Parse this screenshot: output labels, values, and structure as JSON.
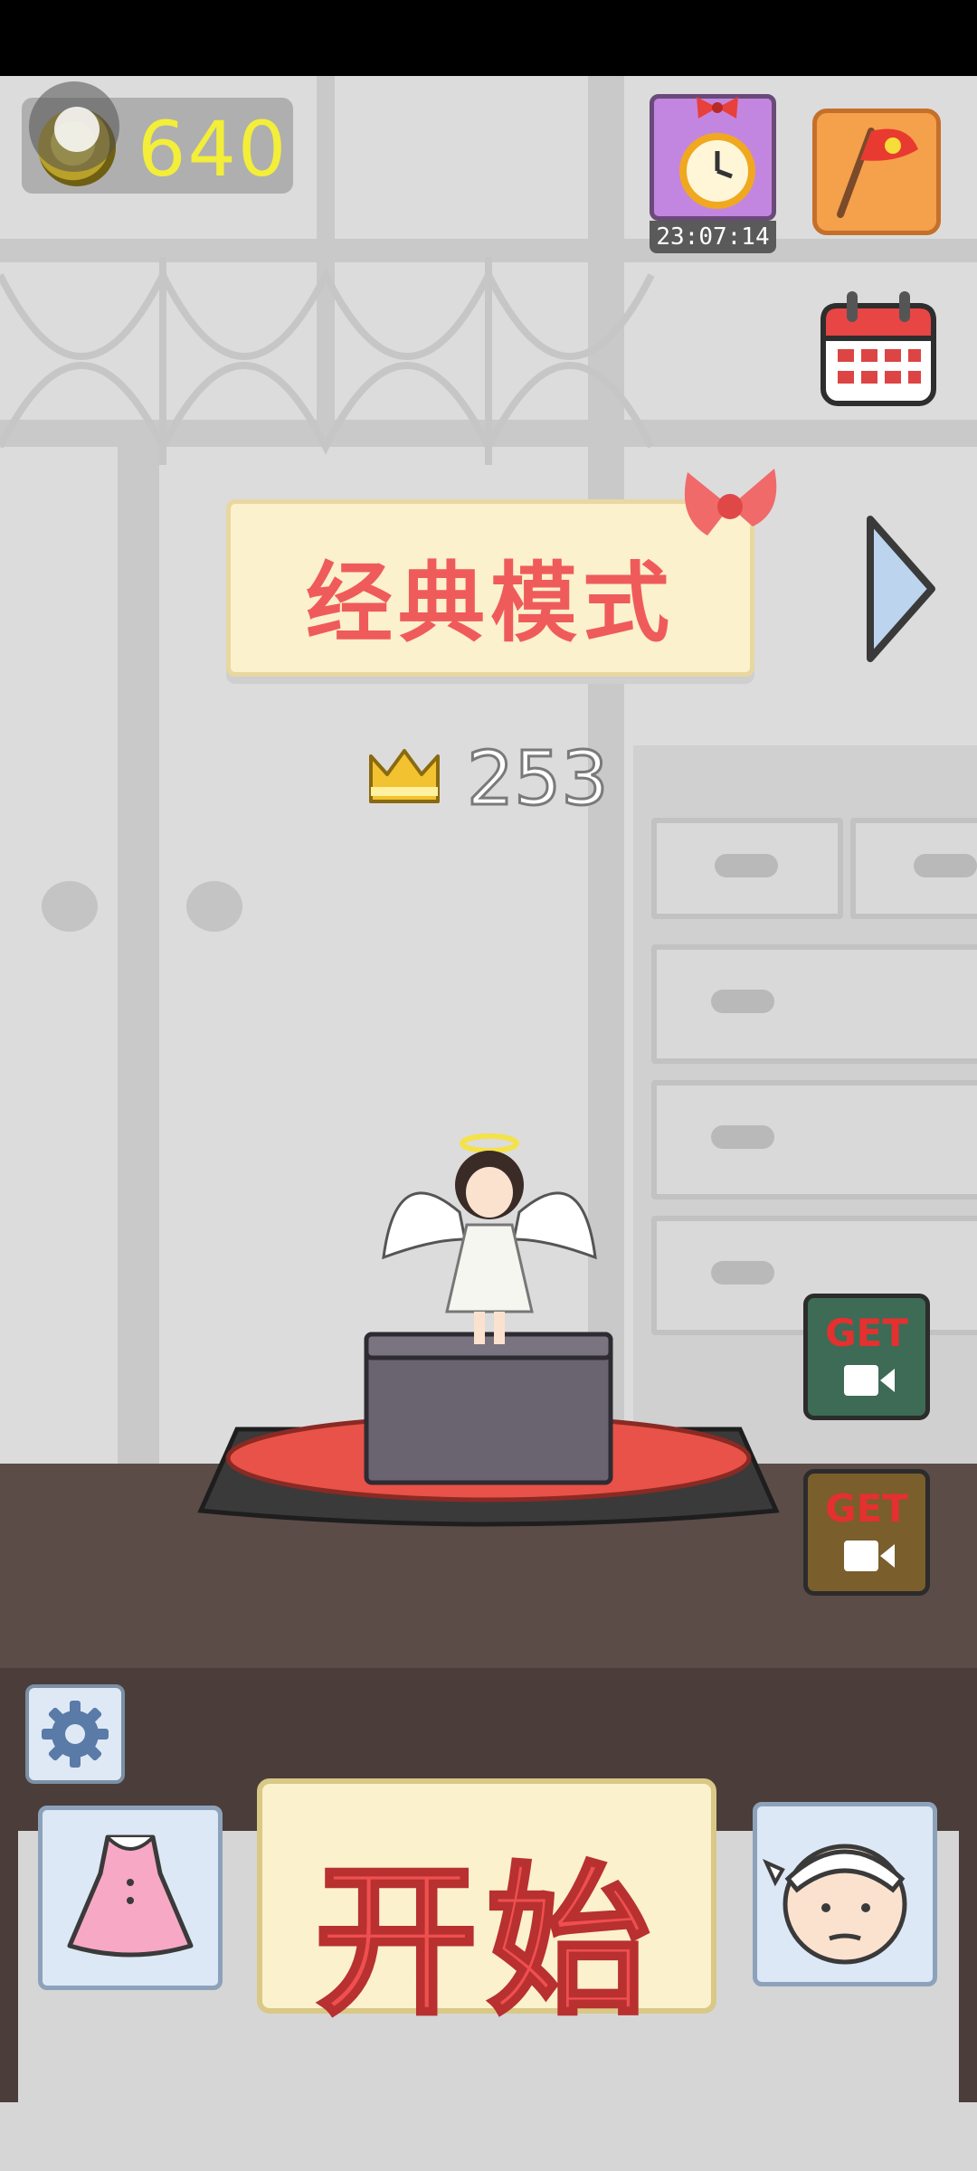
{
  "hud": {
    "coins": "640",
    "timer": "23:07:14"
  },
  "mode": {
    "title": "经典模式",
    "best_score": "253"
  },
  "side_buttons": {
    "get_green": "GET",
    "get_brown": "GET"
  },
  "start": {
    "label": "开始"
  },
  "colors": {
    "accent_red": "#ef5b5b",
    "coin_yellow": "#f3ee39",
    "banner_bg": "#fbf1cc"
  },
  "icons": [
    "coin-icon",
    "alarm-clock-icon",
    "flag-icon",
    "calendar-icon",
    "bow-icon",
    "next-arrow-icon",
    "crown-icon",
    "video-icon",
    "gear-icon",
    "dress-icon",
    "old-man-face-icon"
  ]
}
